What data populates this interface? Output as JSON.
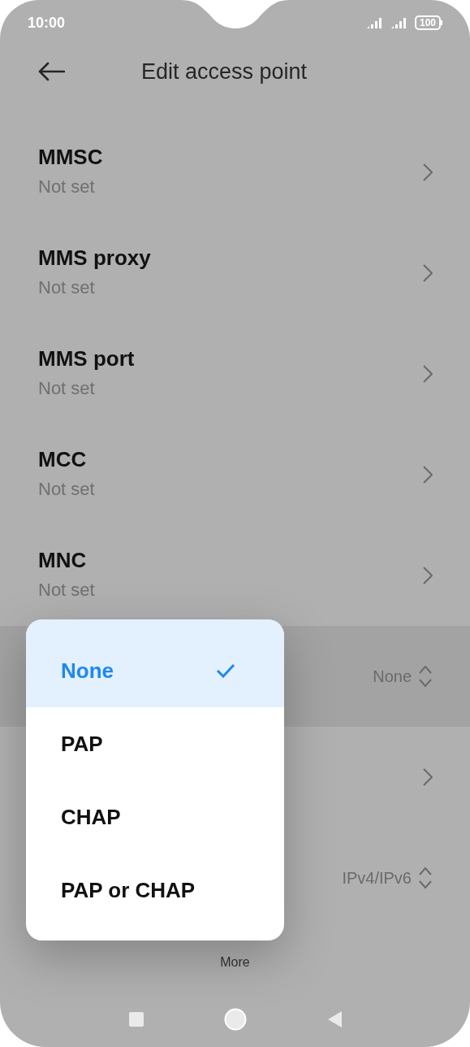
{
  "status_bar": {
    "time": "10:00",
    "battery": "100"
  },
  "header": {
    "title": "Edit access point"
  },
  "rows": [
    {
      "kind": "nav",
      "title": "MMSC",
      "subtitle": "Not set",
      "highlighted": false
    },
    {
      "kind": "nav",
      "title": "MMS proxy",
      "subtitle": "Not set",
      "highlighted": false
    },
    {
      "kind": "nav",
      "title": "MMS port",
      "subtitle": "Not set",
      "highlighted": false
    },
    {
      "kind": "nav",
      "title": "MCC",
      "subtitle": "Not set",
      "highlighted": false
    },
    {
      "kind": "nav",
      "title": "MNC",
      "subtitle": "Not set",
      "highlighted": false
    },
    {
      "kind": "select",
      "value": "None",
      "highlighted": true
    },
    {
      "kind": "nav",
      "highlighted": false
    },
    {
      "kind": "select",
      "value": "IPv4/IPv6",
      "highlighted": false
    }
  ],
  "footer": {
    "more": "More"
  },
  "menu": {
    "items": [
      {
        "label": "None",
        "selected": true
      },
      {
        "label": "PAP",
        "selected": false
      },
      {
        "label": "CHAP",
        "selected": false
      },
      {
        "label": "PAP or CHAP",
        "selected": false
      }
    ]
  }
}
